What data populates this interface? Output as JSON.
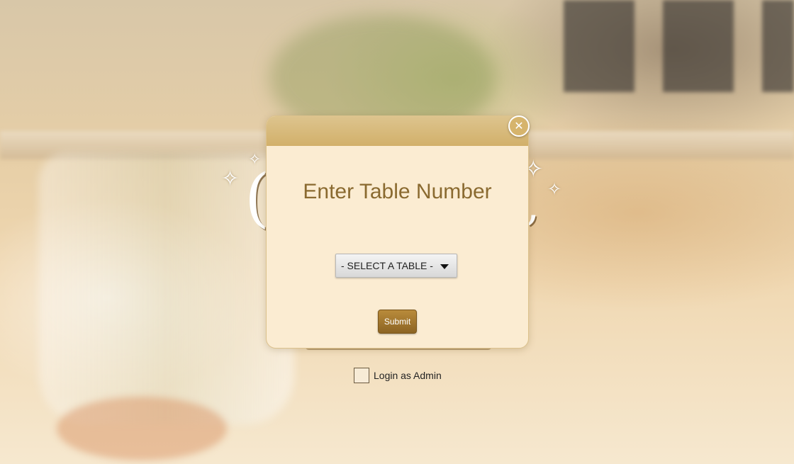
{
  "dialog": {
    "title": "Enter Table Number",
    "close_icon": "close-circle-icon",
    "select": {
      "selected": "- SELECT A TABLE -",
      "icon": "caret-down-icon"
    },
    "submit_label": "Submit"
  },
  "admin": {
    "checked": false,
    "label": "Login as Admin"
  },
  "colors": {
    "accent_gold": "#d2b06a",
    "title_text": "#8a6a30",
    "dialog_bg": "#fbecd2",
    "submit_bg": "#9a702c"
  }
}
